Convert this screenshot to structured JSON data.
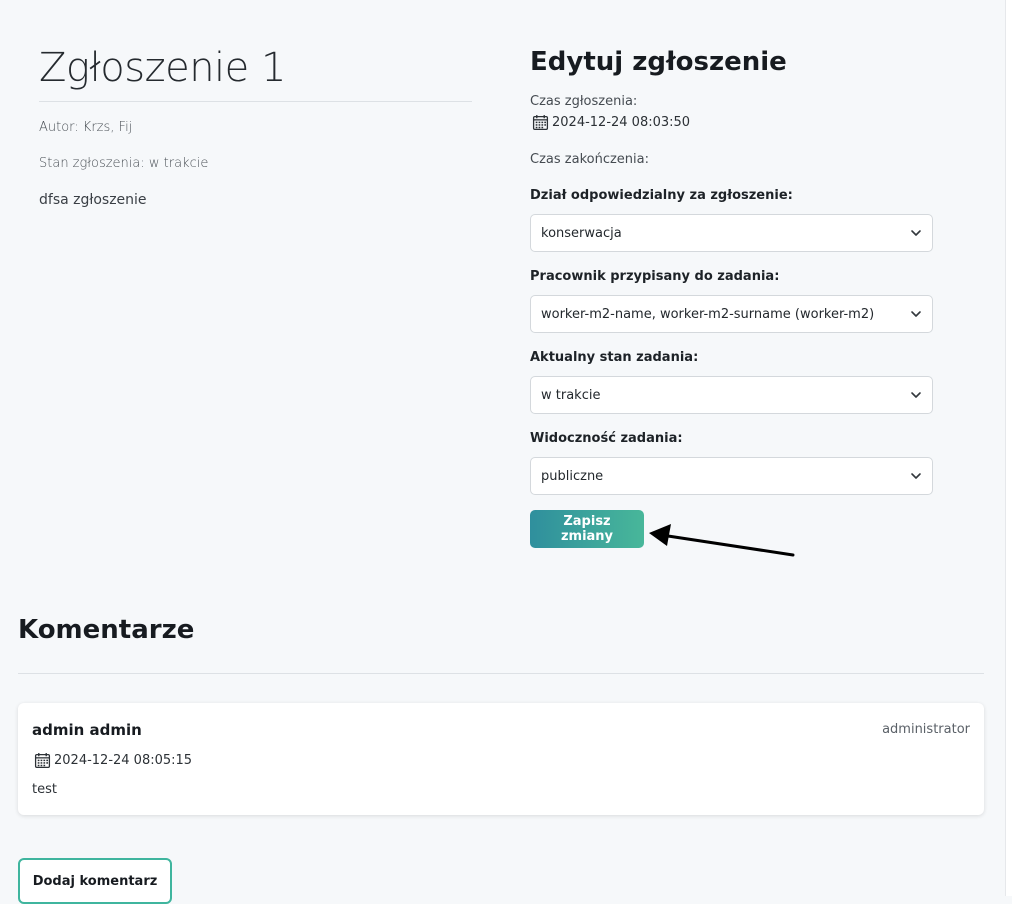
{
  "ticket": {
    "title": "Zgłoszenie 1",
    "author": "Autor: Krzs, Fij",
    "status": "Stan zgłoszenia: w trakcie",
    "description": "dfsa zgłoszenie"
  },
  "edit_form": {
    "title": "Edytuj zgłoszenie",
    "created_label": "Czas zgłoszenia:",
    "created_value": "2024-12-24 08:03:50",
    "finished_label": "Czas zakończenia:",
    "department_label": "Dział odpowiedzialny za zgłoszenie:",
    "department_value": "konserwacja",
    "worker_label": "Pracownik przypisany do zadania:",
    "worker_value": "worker-m2-name, worker-m2-surname (worker-m2)",
    "state_label": "Aktualny stan zadania:",
    "state_value": "w trakcie",
    "visibility_label": "Widoczność zadania:",
    "visibility_value": "publiczne",
    "save_label": "Zapisz zmiany"
  },
  "comments": {
    "title": "Komentarze",
    "items": [
      {
        "author": "admin admin",
        "role": "administrator",
        "date": "2024-12-24 08:05:15",
        "text": "test"
      }
    ],
    "add_label": "Dodaj komentarz"
  },
  "icons": {
    "calendar": "calendar-icon",
    "chevron": "chevron-down-icon"
  },
  "colors": {
    "accent_start": "#2f8f9d",
    "accent_end": "#48b79a",
    "outline": "#3fb59e"
  }
}
